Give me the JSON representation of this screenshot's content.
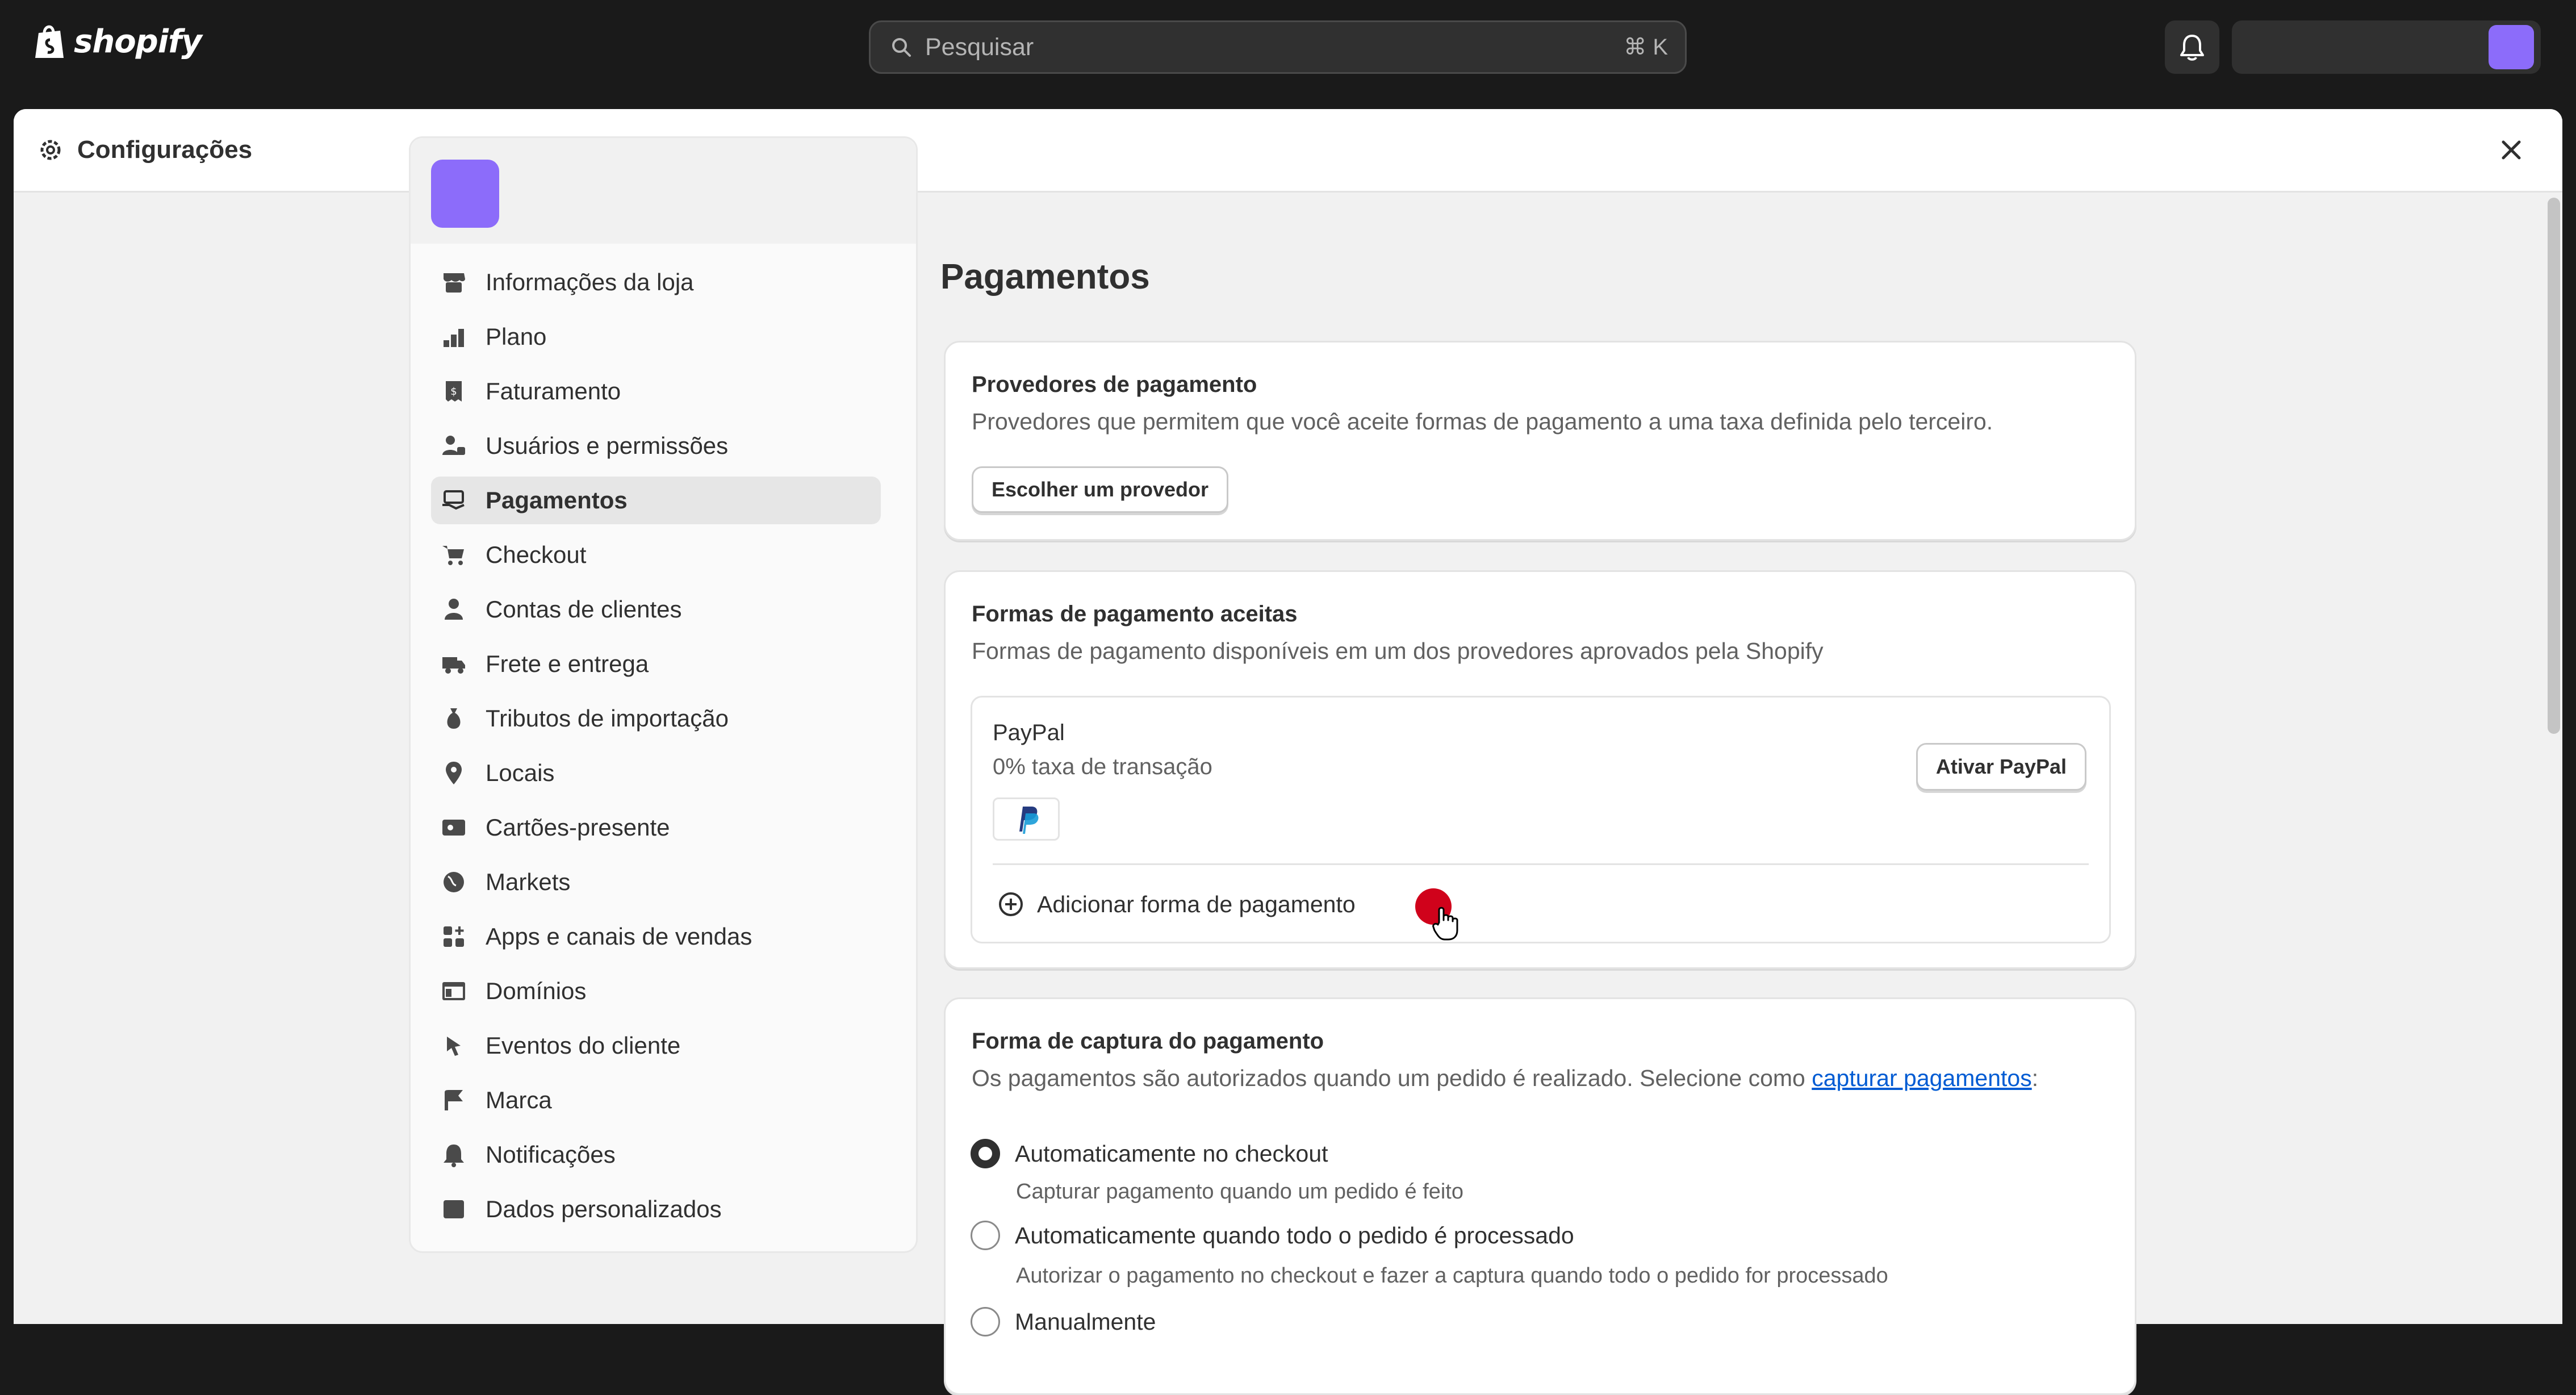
{
  "topbar": {
    "logo_text": "shopify",
    "search_placeholder": "Pesquisar",
    "search_shortcut": "⌘ K"
  },
  "modal": {
    "title": "Configurações"
  },
  "sidebar": {
    "items": [
      {
        "label": "Informações da loja",
        "icon": "store-icon"
      },
      {
        "label": "Plano",
        "icon": "plan-icon"
      },
      {
        "label": "Faturamento",
        "icon": "receipt-icon"
      },
      {
        "label": "Usuários e permissões",
        "icon": "users-icon"
      },
      {
        "label": "Pagamentos",
        "icon": "payments-icon",
        "active": true
      },
      {
        "label": "Checkout",
        "icon": "cart-icon"
      },
      {
        "label": "Contas de clientes",
        "icon": "person-icon"
      },
      {
        "label": "Frete e entrega",
        "icon": "truck-icon"
      },
      {
        "label": "Tributos de importação",
        "icon": "duties-icon"
      },
      {
        "label": "Locais",
        "icon": "location-icon"
      },
      {
        "label": "Cartões-presente",
        "icon": "gift-card-icon"
      },
      {
        "label": "Markets",
        "icon": "globe-icon"
      },
      {
        "label": "Apps e canais de vendas",
        "icon": "apps-icon"
      },
      {
        "label": "Domínios",
        "icon": "domains-icon"
      },
      {
        "label": "Eventos do cliente",
        "icon": "cursor-events-icon"
      },
      {
        "label": "Marca",
        "icon": "brand-icon"
      },
      {
        "label": "Notificações",
        "icon": "bell-icon"
      },
      {
        "label": "Dados personalizados",
        "icon": "data-icon"
      }
    ]
  },
  "main": {
    "title": "Pagamentos",
    "providers_card": {
      "title": "Provedores de pagamento",
      "subtitle": "Provedores que permitem que você aceite formas de pagamento a uma taxa definida pelo terceiro.",
      "button": "Escolher um provedor"
    },
    "methods_card": {
      "title": "Formas de pagamento aceitas",
      "subtitle": "Formas de pagamento disponíveis em um dos provedores aprovados pela Shopify",
      "paypal_name": "PayPal",
      "paypal_fee": "0% taxa de transação",
      "paypal_button": "Ativar PayPal",
      "add_method": "Adicionar forma de pagamento"
    },
    "capture_card": {
      "title": "Forma de captura do pagamento",
      "subtitle_prefix": "Os pagamentos são autorizados quando um pedido é realizado. Selecione como ",
      "subtitle_link": "capturar pagamentos",
      "subtitle_suffix": ":",
      "options": [
        {
          "label": "Automaticamente no checkout",
          "help": "Capturar pagamento quando um pedido é feito",
          "selected": true
        },
        {
          "label": "Automaticamente quando todo o pedido é processado",
          "help": "Autorizar o pagamento no checkout e fazer a captura quando todo o pedido for processado",
          "selected": false
        },
        {
          "label": "Manualmente",
          "help": "",
          "selected": false
        }
      ]
    }
  },
  "colors": {
    "topbar": "#1a1a1a",
    "accent_avatar": "#8c6cfa",
    "link": "#005bd3",
    "cursor_marker": "#d0021b"
  }
}
